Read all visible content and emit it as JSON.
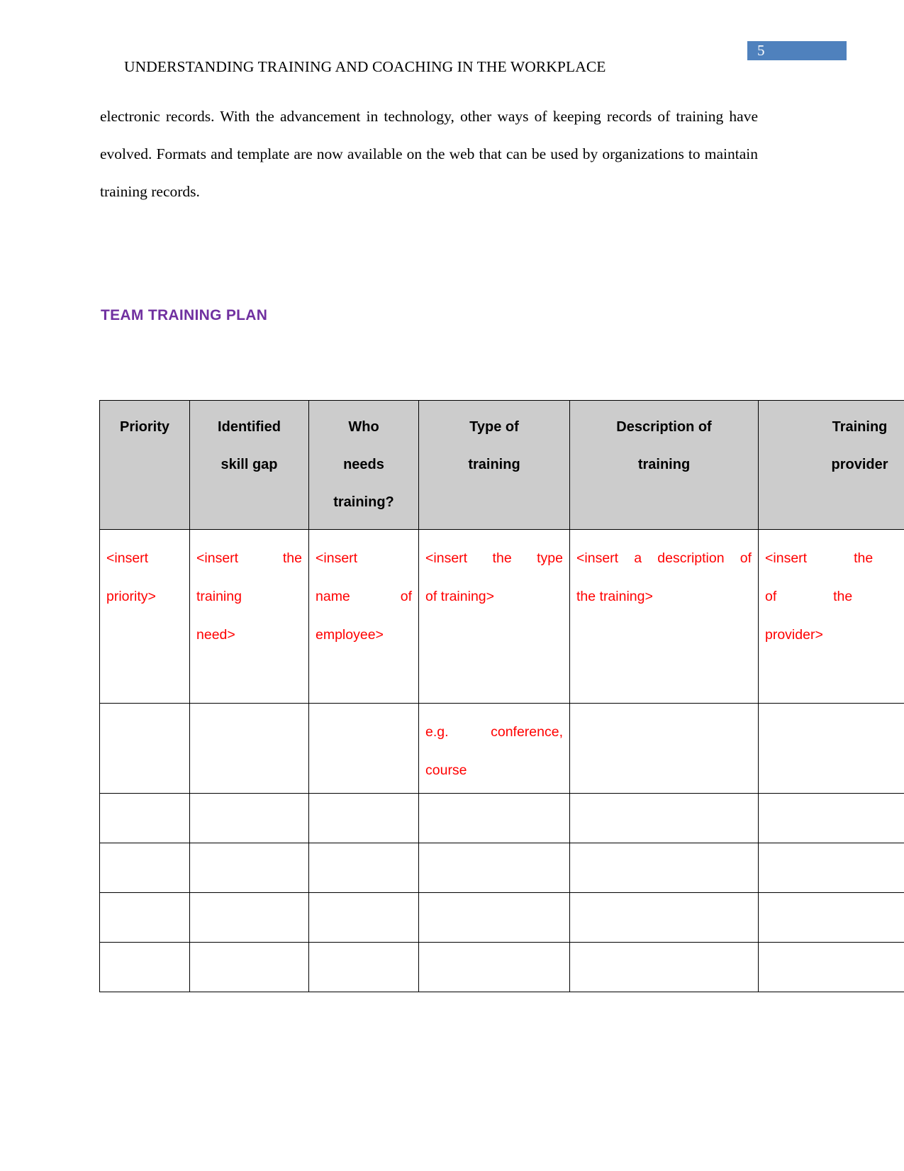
{
  "page": {
    "number": "5",
    "badge_color": "#4f81bd",
    "header": "UNDERSTANDING TRAINING AND COACHING IN THE WORKPLACE",
    "paragraph": "electronic records. With the advancement in technology, other ways of keeping records of training have evolved. Formats and template are now available on the web that can be used by organizations to maintain training records.",
    "section_heading": "TEAM TRAINING PLAN",
    "heading_color": "#7030a0"
  },
  "table": {
    "header_bg": "#cccccc",
    "placeholder_color": "#ff0000",
    "columns": [
      {
        "label_line1": "Priority",
        "label_line2": "",
        "label_line3": ""
      },
      {
        "label_line1": "Identified",
        "label_line2": "skill gap",
        "label_line3": ""
      },
      {
        "label_line1": "Who",
        "label_line2": "needs",
        "label_line3": "training?"
      },
      {
        "label_line1": "Type of",
        "label_line2": "training",
        "label_line3": ""
      },
      {
        "label_line1": "Description of",
        "label_line2": "training",
        "label_line3": ""
      },
      {
        "label_line1": "Training",
        "label_line2": "provider",
        "label_line3": ""
      }
    ],
    "rows": [
      {
        "cells": [
          {
            "line1": "<insert",
            "line2": "priority>",
            "line3": ""
          },
          {
            "line1": "<insert the",
            "line2": "training",
            "line3": "need>"
          },
          {
            "line1": "<insert",
            "line2": "name of",
            "line3": "employee>"
          },
          {
            "line1": "<insert the type",
            "line2": "of training>",
            "line3": ""
          },
          {
            "line1": "<insert a description of",
            "line2": "the training>",
            "line3": ""
          },
          {
            "line1": "<insert the name",
            "line2": "of the training",
            "line3": "provider>"
          }
        ]
      },
      {
        "cells": [
          {
            "line1": "",
            "line2": "",
            "line3": ""
          },
          {
            "line1": "",
            "line2": "",
            "line3": ""
          },
          {
            "line1": "",
            "line2": "",
            "line3": ""
          },
          {
            "line1": "e.g. conference,",
            "line2": "course",
            "line3": ""
          },
          {
            "line1": "",
            "line2": "",
            "line3": ""
          },
          {
            "line1": "",
            "line2": "",
            "line3": ""
          }
        ]
      },
      {
        "cells": [
          {},
          {},
          {},
          {},
          {},
          {}
        ]
      },
      {
        "cells": [
          {},
          {},
          {},
          {},
          {},
          {}
        ]
      },
      {
        "cells": [
          {},
          {},
          {},
          {},
          {},
          {}
        ]
      },
      {
        "cells": [
          {},
          {},
          {},
          {},
          {},
          {}
        ]
      }
    ]
  }
}
